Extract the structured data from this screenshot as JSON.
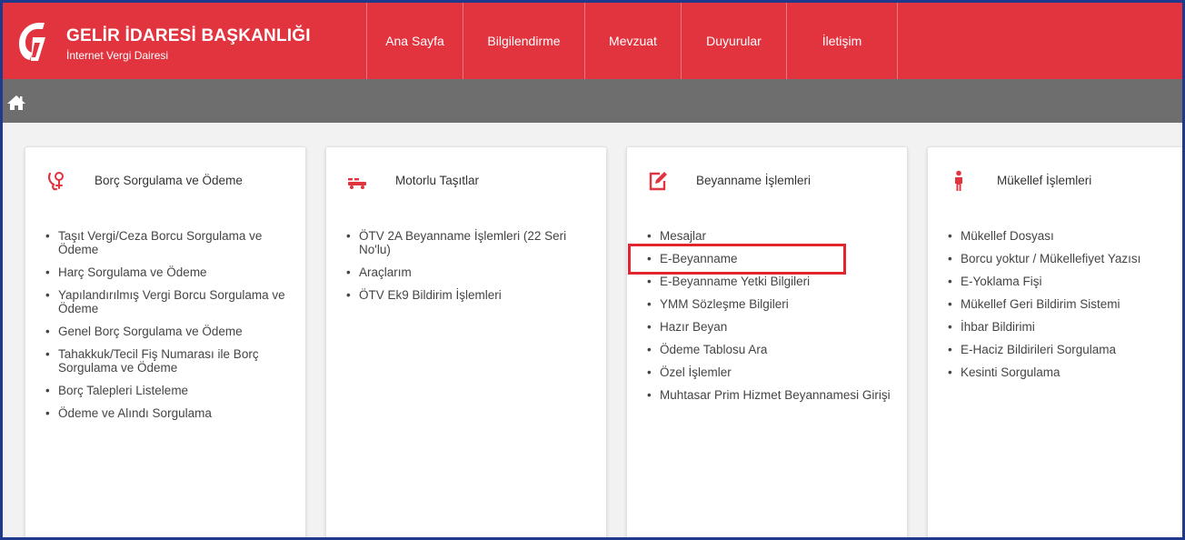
{
  "header": {
    "title": "GELİR İDARESİ BAŞKANLIĞI",
    "subtitle": "İnternet Vergi Dairesi",
    "nav": [
      {
        "label": "Ana Sayfa"
      },
      {
        "label": "Bilgilendirme"
      },
      {
        "label": "Mevzuat"
      },
      {
        "label": "Duyurular"
      },
      {
        "label": "İletişim"
      }
    ]
  },
  "colors": {
    "brand_red": "#e1343f",
    "subbar_gray": "#6e6e6e",
    "frame_blue": "#1f3a8c",
    "highlight_red": "#e3252f"
  },
  "cards": [
    {
      "icon": "debt-payment-icon",
      "title": "Borç Sorgulama ve Ödeme",
      "items": [
        "Taşıt Vergi/Ceza Borcu Sorgulama ve Ödeme",
        "Harç Sorgulama ve Ödeme",
        "Yapılandırılmış Vergi Borcu Sorgulama ve Ödeme",
        "Genel Borç Sorgulama ve Ödeme",
        "Tahakkuk/Tecil Fiş Numarası ile Borç Sorgulama ve Ödeme",
        "Borç Talepleri Listeleme",
        "Ödeme ve Alındı Sorgulama"
      ]
    },
    {
      "icon": "vehicle-icon",
      "title": "Motorlu Taşıtlar",
      "items": [
        "ÖTV 2A Beyanname İşlemleri (22 Seri No'lu)",
        "Araçlarım",
        "ÖTV Ek9 Bildirim İşlemleri"
      ]
    },
    {
      "icon": "edit-document-icon",
      "title": "Beyanname İşlemleri",
      "items": [
        "Mesajlar",
        "E-Beyanname",
        "E-Beyanname Yetki Bilgileri",
        "YMM Sözleşme Bilgileri",
        "Hazır Beyan",
        "Ödeme Tablosu Ara",
        "Özel İşlemler",
        "Muhtasar Prim Hizmet Beyannamesi Girişi"
      ]
    },
    {
      "icon": "person-icon",
      "title": "Mükellef İşlemleri",
      "items": [
        "Mükellef Dosyası",
        "Borcu yoktur / Mükellefiyet Yazısı",
        "E-Yoklama Fişi",
        "Mükellef Geri Bildirim Sistemi",
        "İhbar Bildirimi",
        "E-Haciz Bildirileri Sorgulama",
        "Kesinti Sorgulama"
      ]
    }
  ]
}
